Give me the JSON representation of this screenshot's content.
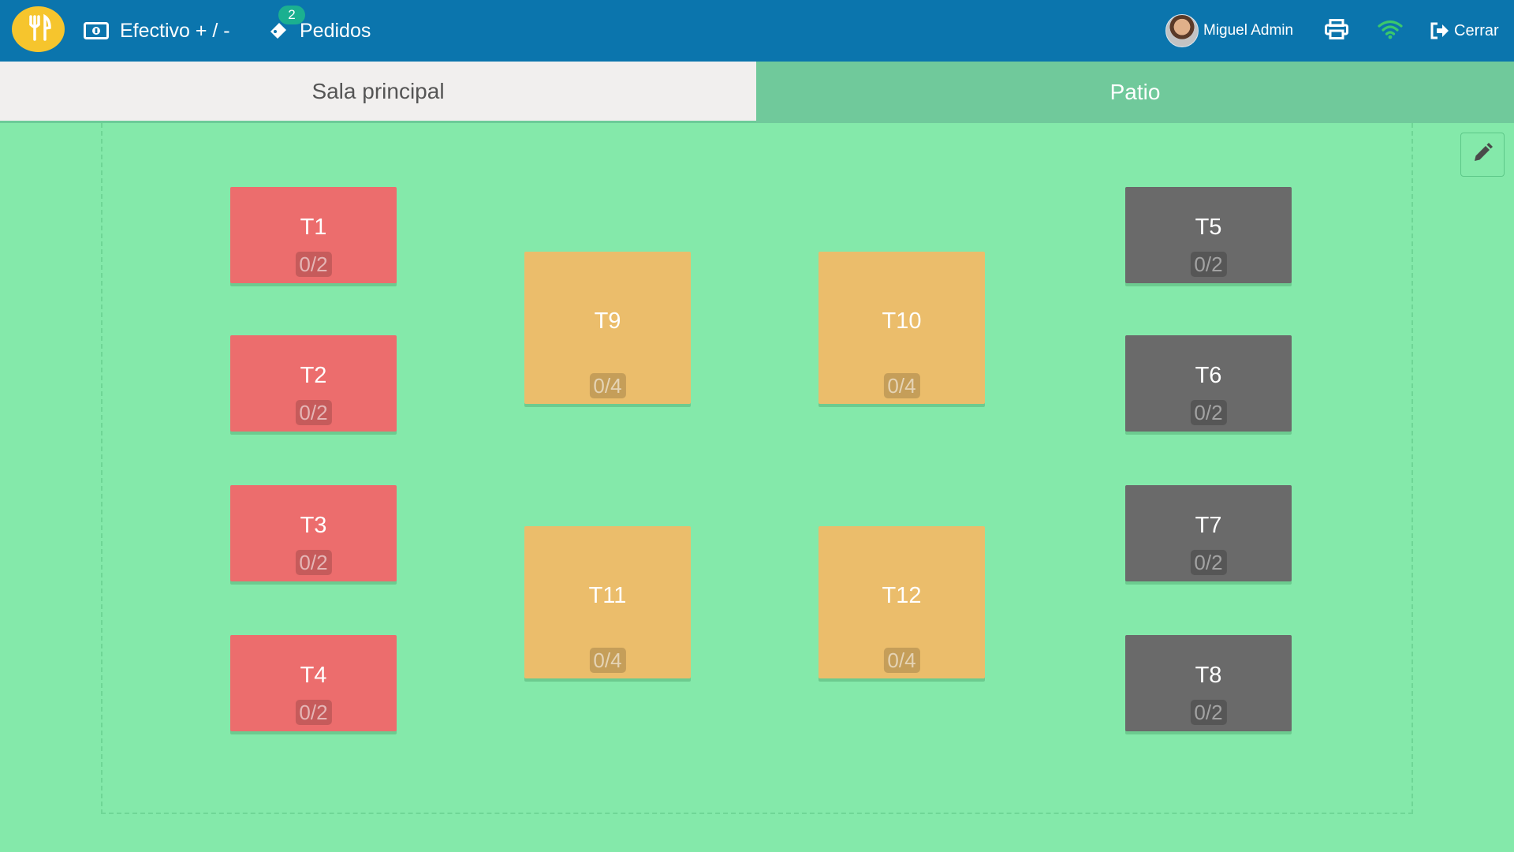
{
  "topbar": {
    "logo_icon": "fork-knife-icon",
    "cash_label": "Efectivo + / -",
    "cash_icon": "money-icon",
    "orders_label": "Pedidos",
    "orders_icon": "ticket-icon",
    "orders_badge": "2",
    "user_name": "Miguel Admin",
    "print_icon": "printer-icon",
    "connection_icon": "wifi-icon",
    "logout_label": "Cerrar",
    "logout_icon": "sign-out-icon"
  },
  "rooms": {
    "tabs": [
      {
        "label": "Sala principal",
        "active": false
      },
      {
        "label": "Patio",
        "active": true
      }
    ]
  },
  "floor": {
    "edit_icon": "pencil-icon",
    "tables": [
      {
        "name": "T1",
        "seats": "0/2",
        "status": "occupied"
      },
      {
        "name": "T2",
        "seats": "0/2",
        "status": "occupied"
      },
      {
        "name": "T3",
        "seats": "0/2",
        "status": "occupied"
      },
      {
        "name": "T4",
        "seats": "0/2",
        "status": "occupied"
      },
      {
        "name": "T5",
        "seats": "0/2",
        "status": "unavailable"
      },
      {
        "name": "T6",
        "seats": "0/2",
        "status": "unavailable"
      },
      {
        "name": "T7",
        "seats": "0/2",
        "status": "unavailable"
      },
      {
        "name": "T8",
        "seats": "0/2",
        "status": "unavailable"
      },
      {
        "name": "T9",
        "seats": "0/4",
        "status": "reserved"
      },
      {
        "name": "T10",
        "seats": "0/4",
        "status": "reserved"
      },
      {
        "name": "T11",
        "seats": "0/4",
        "status": "reserved"
      },
      {
        "name": "T12",
        "seats": "0/4",
        "status": "reserved"
      }
    ]
  },
  "colors": {
    "topbar": "#0b75ad",
    "floor": "#84e9aa",
    "occupied": "#ec6d6d",
    "reserved": "#ebbd6b",
    "unavailable": "#6a6a6a",
    "badge": "#1bb090",
    "logo": "#f6c52d"
  }
}
